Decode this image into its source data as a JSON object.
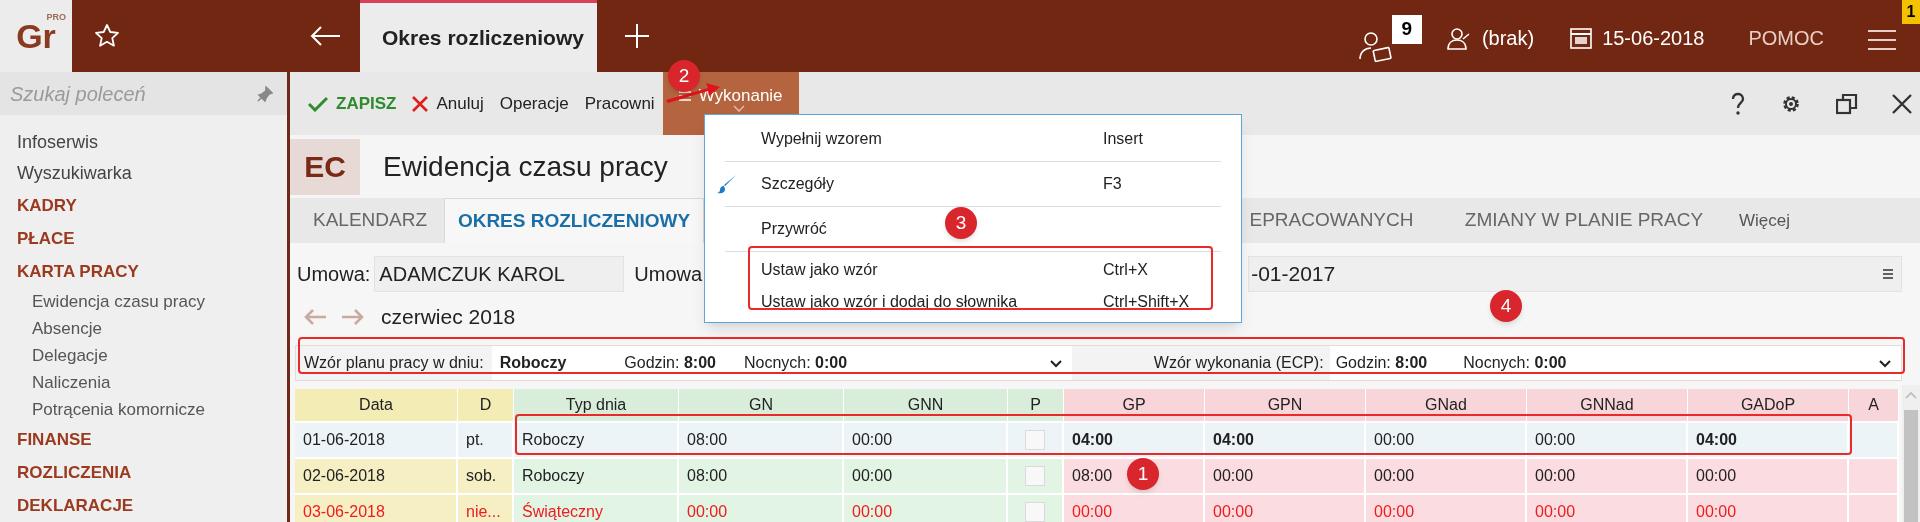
{
  "app": {
    "logo": "Gr",
    "logo_badge": "PRO"
  },
  "top_bar": {
    "open_tab": "Okres rozliczeniowy",
    "notifications": "9",
    "user": "(brak)",
    "date": "15-06-2018",
    "help": "POMOC",
    "menu_badge": "1"
  },
  "sidebar": {
    "search_placeholder": "Szukaj poleceń",
    "items": [
      {
        "label": "Infoserwis",
        "kind": "link"
      },
      {
        "label": "Wyszukiwarka",
        "kind": "link"
      },
      {
        "label": "KADRY",
        "kind": "section"
      },
      {
        "label": "PŁACE",
        "kind": "section"
      },
      {
        "label": "KARTA PRACY",
        "kind": "section",
        "children": [
          {
            "label": "Ewidencja czasu pracy"
          },
          {
            "label": "Absencje"
          },
          {
            "label": "Delegacje"
          },
          {
            "label": "Naliczenia"
          },
          {
            "label": "Potrącenia komornicze"
          }
        ]
      },
      {
        "label": "FINANSE",
        "kind": "section"
      },
      {
        "label": "ROZLICZENIA",
        "kind": "section"
      },
      {
        "label": "DEKLARACJE",
        "kind": "section"
      }
    ]
  },
  "toolbar": {
    "buttons": [
      {
        "label": "ZAPISZ",
        "kind": "save",
        "selected": false
      },
      {
        "label": "Anuluj",
        "kind": "cancel",
        "selected": false
      },
      {
        "label": "Operacje",
        "kind": "plain",
        "selected": false
      },
      {
        "label": "Pracowni",
        "kind": "plain",
        "selected": false
      },
      {
        "label": "Wykonanie",
        "kind": "menu",
        "selected": true
      }
    ]
  },
  "menu": {
    "groups": [
      [
        {
          "label": "Wypełnij wzorem",
          "shortcut": "Insert",
          "kind": "plain"
        }
      ],
      [
        {
          "label": "Szczegóły",
          "shortcut": "F3",
          "kind": "brush"
        }
      ],
      [
        {
          "label": "Przywróć",
          "kind": "plain"
        }
      ],
      [
        {
          "label": "Ustaw jako wzór",
          "shortcut": "Ctrl+X",
          "kind": "plain"
        },
        {
          "label": "Ustaw jako wzór i dodaj do słownika",
          "shortcut": "Ctrl+Shift+X",
          "kind": "plain"
        }
      ]
    ]
  },
  "document": {
    "badge": "EC",
    "title": "Ewidencja czasu pracy"
  },
  "tabs": [
    {
      "label": "KALENDARZ",
      "selected": false
    },
    {
      "label": "OKRES ROZLICZENIOWY",
      "selected": true
    },
    {
      "label": "EPRACOWANYCH",
      "selected": false
    },
    {
      "label": "ZMIANY W PLANIE PRACY",
      "selected": false
    }
  ],
  "more_tabs": "Więcej",
  "contract": {
    "label": "Umowa:",
    "value": "ADAMCZUK KAROL",
    "label_2": "Umowa",
    "value_2": "-01-2017"
  },
  "period": "czerwiec 2018",
  "plan_pattern": {
    "label": "Wzór planu pracy w dniu:",
    "day_type": "Roboczy",
    "hours_label": "Godzin:",
    "hours": "8:00",
    "night_label": "Nocnych:",
    "night": "0:00"
  },
  "execution_pattern": {
    "label": "Wzór wykonania (ECP):",
    "hours_label": "Godzin:",
    "hours": "8:00",
    "night_label": "Nocnych:",
    "night": "0:00"
  },
  "table": {
    "columns": [
      {
        "label": "Data"
      },
      {
        "label": "D"
      },
      {
        "label": "Typ dnia"
      },
      {
        "label": "GN"
      },
      {
        "label": "GNN"
      },
      {
        "label": "P"
      },
      {
        "label": "GP"
      },
      {
        "label": "GPN"
      },
      {
        "label": "GNad"
      },
      {
        "label": "GNNad"
      },
      {
        "label": "GADoP"
      },
      {
        "label": "A"
      }
    ],
    "rows": [
      {
        "selected": true,
        "holiday": false,
        "cells": [
          {
            "text": "01-06-2018",
            "bold": false
          },
          {
            "text": "pt.",
            "bold": false
          },
          {
            "text": "Roboczy",
            "bold": false
          },
          {
            "text": "08:00",
            "bold": false
          },
          {
            "text": "00:00",
            "bold": false
          },
          {
            "kind": "checkbox",
            "checked": false
          },
          {
            "text": "04:00",
            "bold": true
          },
          {
            "text": "04:00",
            "bold": true
          },
          {
            "text": "00:00",
            "bold": false
          },
          {
            "text": "00:00",
            "bold": false
          },
          {
            "text": "04:00",
            "bold": true
          },
          {
            "kind": "empty"
          }
        ]
      },
      {
        "selected": false,
        "holiday": false,
        "cells": [
          {
            "text": "02-06-2018",
            "bold": false
          },
          {
            "text": "sob.",
            "bold": false
          },
          {
            "text": "Roboczy",
            "bold": false
          },
          {
            "text": "08:00",
            "bold": false
          },
          {
            "text": "00:00",
            "bold": false
          },
          {
            "kind": "checkbox",
            "checked": false
          },
          {
            "text": "08:00",
            "bold": false
          },
          {
            "text": "00:00",
            "bold": false
          },
          {
            "text": "00:00",
            "bold": false
          },
          {
            "text": "00:00",
            "bold": false
          },
          {
            "text": "00:00",
            "bold": false
          },
          {
            "kind": "empty"
          }
        ]
      },
      {
        "selected": false,
        "holiday": true,
        "cells": [
          {
            "text": "03-06-2018",
            "bold": false
          },
          {
            "text": "nie...",
            "bold": false
          },
          {
            "text": "Świąteczny",
            "bold": false
          },
          {
            "text": "00:00",
            "bold": false
          },
          {
            "text": "00:00",
            "bold": false
          },
          {
            "kind": "checkbox",
            "checked": false
          },
          {
            "text": "00:00",
            "bold": false
          },
          {
            "text": "00:00",
            "bold": false
          },
          {
            "text": "00:00",
            "bold": false
          },
          {
            "text": "00:00",
            "bold": false
          },
          {
            "text": "00:00",
            "bold": false
          },
          {
            "kind": "empty"
          }
        ]
      }
    ]
  },
  "annotations": [
    {
      "number": "1"
    },
    {
      "number": "2"
    },
    {
      "number": "3"
    },
    {
      "number": "4"
    }
  ]
}
